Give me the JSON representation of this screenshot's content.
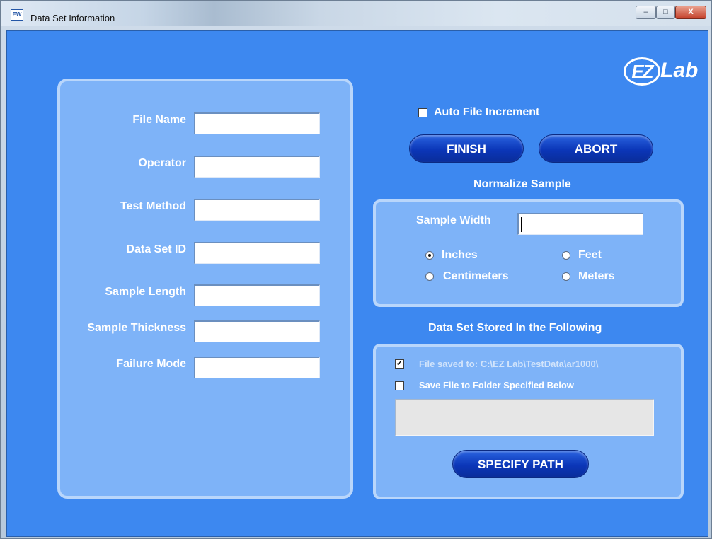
{
  "window": {
    "title": "Data Set Information",
    "app_icon_text": "EW",
    "controls": {
      "minimize": "–",
      "maximize": "□",
      "close": "X"
    }
  },
  "logo": {
    "ez": "EZ",
    "lab": "Lab"
  },
  "form": {
    "file_name_label": "File Name",
    "operator_label": "Operator",
    "test_method_label": "Test Method",
    "data_set_id_label": "Data Set ID",
    "sample_length_label": "Sample Length",
    "sample_thickness_label": "Sample Thickness",
    "failure_mode_label": "Failure Mode",
    "file_name_value": "",
    "operator_value": "",
    "test_method_value": "",
    "data_set_id_value": "",
    "sample_length_value": "",
    "sample_thickness_value": "",
    "failure_mode_value": ""
  },
  "auto_increment": {
    "label": "Auto File Increment",
    "checked": false
  },
  "buttons": {
    "finish": "FINISH",
    "abort": "ABORT",
    "specify_path": "SPECIFY PATH"
  },
  "normalize": {
    "heading": "Normalize Sample",
    "sample_width_label": "Sample Width",
    "sample_width_value": "",
    "units": [
      {
        "label": "Inches",
        "selected": true
      },
      {
        "label": "Feet",
        "selected": false
      },
      {
        "label": "Centimeters",
        "selected": false
      },
      {
        "label": "Meters",
        "selected": false
      }
    ]
  },
  "storage": {
    "heading": "Data Set Stored In the Following",
    "file_saved_label": "File saved to: C:\\EZ Lab\\TestData\\ar1000\\",
    "file_saved_checked": true,
    "save_to_folder_label": "Save File to Folder Specified Below",
    "save_to_folder_checked": false,
    "folder_path": ""
  },
  "colors": {
    "background": "#3d88f0",
    "panel": "#7eb3f8",
    "button": "#0b36b8"
  }
}
